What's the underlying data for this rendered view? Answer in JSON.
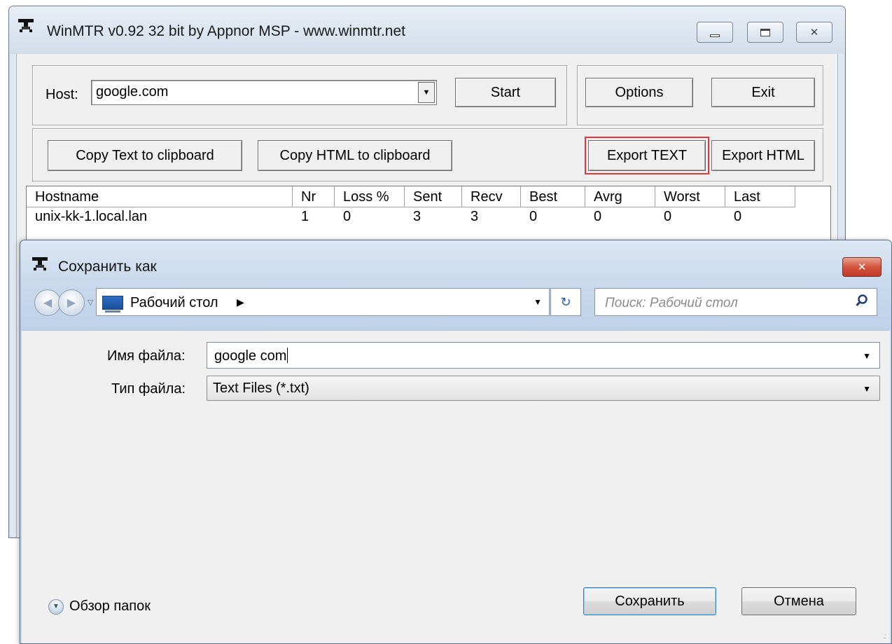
{
  "winmtr": {
    "title": "WinMTR v0.92 32 bit by Appnor MSP - www.winmtr.net",
    "host_label": "Host:",
    "host_value": "google.com",
    "start_label": "Start",
    "options_label": "Options",
    "exit_label": "Exit",
    "copy_text_label": "Copy Text to clipboard",
    "copy_html_label": "Copy HTML to clipboard",
    "export_text_label": "Export TEXT",
    "export_html_label": "Export HTML",
    "columns": [
      "Hostname",
      "Nr",
      "Loss %",
      "Sent",
      "Recv",
      "Best",
      "Avrg",
      "Worst",
      "Last"
    ],
    "rows": [
      [
        "unix-kk-1.local.lan",
        "1",
        "0",
        "3",
        "3",
        "0",
        "0",
        "0",
        "0"
      ]
    ],
    "highlight_color": "#e0383e"
  },
  "save_dialog": {
    "title": "Сохранить как",
    "location": "Рабочий стол",
    "search_placeholder": "Поиск: Рабочий стол",
    "filename_label": "Имя файла:",
    "filename_value": "google com",
    "filetype_label": "Тип файла:",
    "filetype_value": "Text Files (*.txt)",
    "browse_folders_label": "Обзор папок",
    "save_label": "Сохранить",
    "cancel_label": "Отмена"
  }
}
